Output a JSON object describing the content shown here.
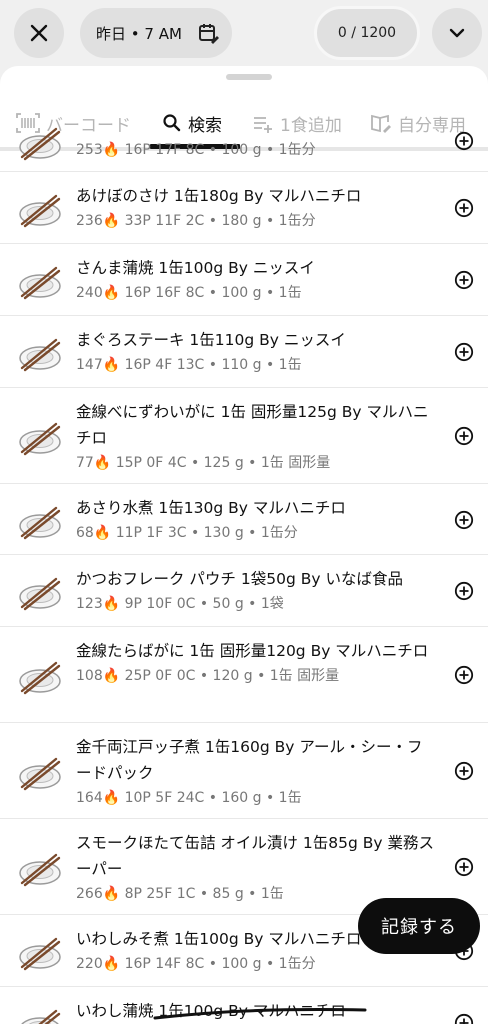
{
  "header": {
    "close_icon": "close-icon",
    "date_label": "昨日 • 7 AM",
    "calendar_icon": "calendar-edit-icon",
    "calorie_counter": "0 / 1200",
    "expand_icon": "chevron-down-icon"
  },
  "tabs": [
    {
      "label": "バーコード",
      "icon": "barcode-icon",
      "active": false
    },
    {
      "label": "検索",
      "icon": "search-icon",
      "active": true
    },
    {
      "label": "1食追加",
      "icon": "add-list-icon",
      "active": false
    },
    {
      "label": "自分専用",
      "icon": "book-edit-icon",
      "active": false
    }
  ],
  "results": [
    {
      "title": "",
      "sub": "253🔥 16P  17F  8C • 100 g • 1缶分",
      "partial": true
    },
    {
      "title": "あけぼのさけ 1缶180g By マルハニチロ",
      "sub": "236🔥 33P  11F  2C • 180 g • 1缶分"
    },
    {
      "title": "さんま蒲焼 1缶100g By ニッスイ",
      "sub": "240🔥 16P  16F  8C • 100 g • 1缶"
    },
    {
      "title": "まぐろステーキ 1缶110g By ニッスイ",
      "sub": "147🔥 16P  4F  13C • 110 g • 1缶"
    },
    {
      "title": "金線べにずわいがに 1缶 固形量125g By マルハニチロ",
      "sub": "77🔥 15P  0F  4C • 125 g • 1缶 固形量"
    },
    {
      "title": "あさり水煮 1缶130g By マルハニチロ",
      "sub": "68🔥 11P  1F  3C • 130 g • 1缶分"
    },
    {
      "title": "かつおフレーク パウチ 1袋50g By いなば食品",
      "sub": "123🔥 9P  10F  0C • 50 g • 1袋"
    },
    {
      "title": "金線たらばがに 1缶 固形量120g By マルハニチロ",
      "sub": "108🔥 25P  0F  0C • 120 g • 1缶 固形量"
    },
    {
      "title": "金千両江戸ッ子煮 1缶160g By アール・シー・フードパック",
      "sub": "164🔥 10P  5F  24C • 160 g • 1缶"
    },
    {
      "title": "スモークほたて缶詰 オイル漬け 1缶85g By 業務スーパー",
      "sub": "266🔥 8P  25F  1C • 85 g • 1缶"
    },
    {
      "title": "いわしみそ煮 1缶100g By マルハニチロ",
      "sub": "220🔥 16P  14F  8C • 100 g • 1缶分"
    },
    {
      "title": "いわし蒲焼 1缶100g By マルハニチロ",
      "sub": "",
      "partial": true
    }
  ],
  "fab": {
    "label": "記録する"
  }
}
